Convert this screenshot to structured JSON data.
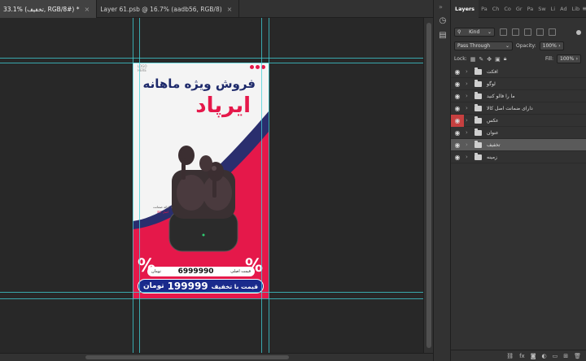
{
  "tabs": [
    {
      "label": "33.1% (تخفیف, RGB/8#) *",
      "active": true
    },
    {
      "label": "Layer 61.psb @ 16.7% (aadb56, RGB/8)",
      "active": false
    }
  ],
  "poster": {
    "logo_text": "LOGO\nHERE",
    "headline": "فروش ویژه ماهانه",
    "product": "ایرپاد",
    "annotation_line1": "با ارائه ضمانت",
    "annotation_line2": "اصل کالا",
    "old_price_label": "قیمت اصلی",
    "old_price_value": "6999990",
    "old_price_currency": "تومان",
    "new_price_label": "قیمت با تخفیف",
    "new_price_value": "199999",
    "new_price_currency": "تومان",
    "percent_sign": "%",
    "colors": {
      "accent": "#e5184a",
      "navy": "#1e2a6b",
      "price_bar": "#1a2a8c"
    }
  },
  "panel": {
    "tabs": [
      "Layers",
      "Pa",
      "Ch",
      "Co",
      "Gr",
      "Pa",
      "Sw",
      "Li",
      "Ad",
      "Lib"
    ],
    "more": "≡",
    "kind_label": "Kind",
    "blend_mode": "Pass Through",
    "opacity_label": "Opacity:",
    "opacity_value": "100%",
    "lock_label": "Lock:",
    "fill_label": "Fill:",
    "fill_value": "100%"
  },
  "layers": [
    {
      "name": "افکت",
      "selected": false,
      "eye_red": false
    },
    {
      "name": "لوگو",
      "selected": false,
      "eye_red": false
    },
    {
      "name": "ما را فالو کنید",
      "selected": false,
      "eye_red": false
    },
    {
      "name": "دارای ضمانت اصل کالا",
      "selected": false,
      "eye_red": false
    },
    {
      "name": "عکس",
      "selected": false,
      "eye_red": true
    },
    {
      "name": "عنوان",
      "selected": false,
      "eye_red": false
    },
    {
      "name": "تخفیف",
      "selected": true,
      "eye_red": false
    },
    {
      "name": "زمینه",
      "selected": false,
      "eye_red": false
    }
  ],
  "icons": {
    "eye": "eye-icon",
    "folder": "folder-icon",
    "chevron": "chevron-right-icon",
    "bottom_bar": [
      "link-icon",
      "fx-icon",
      "mask-icon",
      "adjustment-icon",
      "group-icon",
      "new-layer-icon",
      "trash-icon"
    ]
  }
}
